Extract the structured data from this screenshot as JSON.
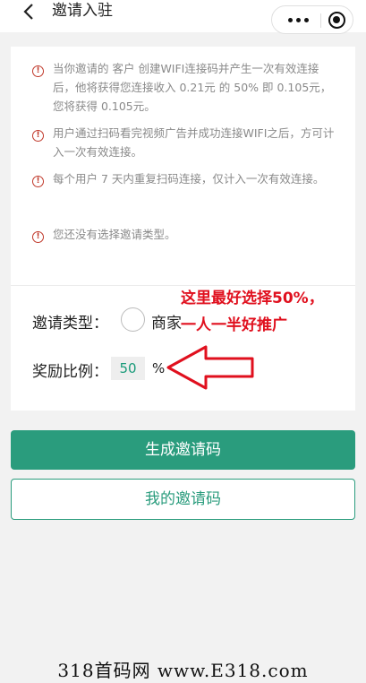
{
  "nav": {
    "title": "邀请入驻"
  },
  "notices": [
    "当你邀请的 客户 创建WIFI连接码并产生一次有效连接后，他将获得您连接收入 0.21元 的 50% 即 0.105元，您将获得 0.105元。",
    "用户通过扫码看完视频广告并成功连接WIFI之后，方可计入一次有效连接。",
    "每个用户 7 天内重复扫码连接，仅计入一次有效连接。",
    "您还没有选择邀请类型。"
  ],
  "form": {
    "type_label": "邀请类型：",
    "type_option": "商家",
    "ratio_label": "奖励比例：",
    "ratio_value": "50",
    "ratio_unit": "%"
  },
  "annotation": {
    "line1": "这里最好选择50%，",
    "line2": "一人一半好推广"
  },
  "buttons": {
    "generate": "生成邀请码",
    "my_codes": "我的邀请码"
  },
  "watermark": "318首码网 www.E318.com",
  "colors": {
    "accent": "#2a9c7d",
    "warning": "#c0392b",
    "annotation": "#e0101e"
  }
}
